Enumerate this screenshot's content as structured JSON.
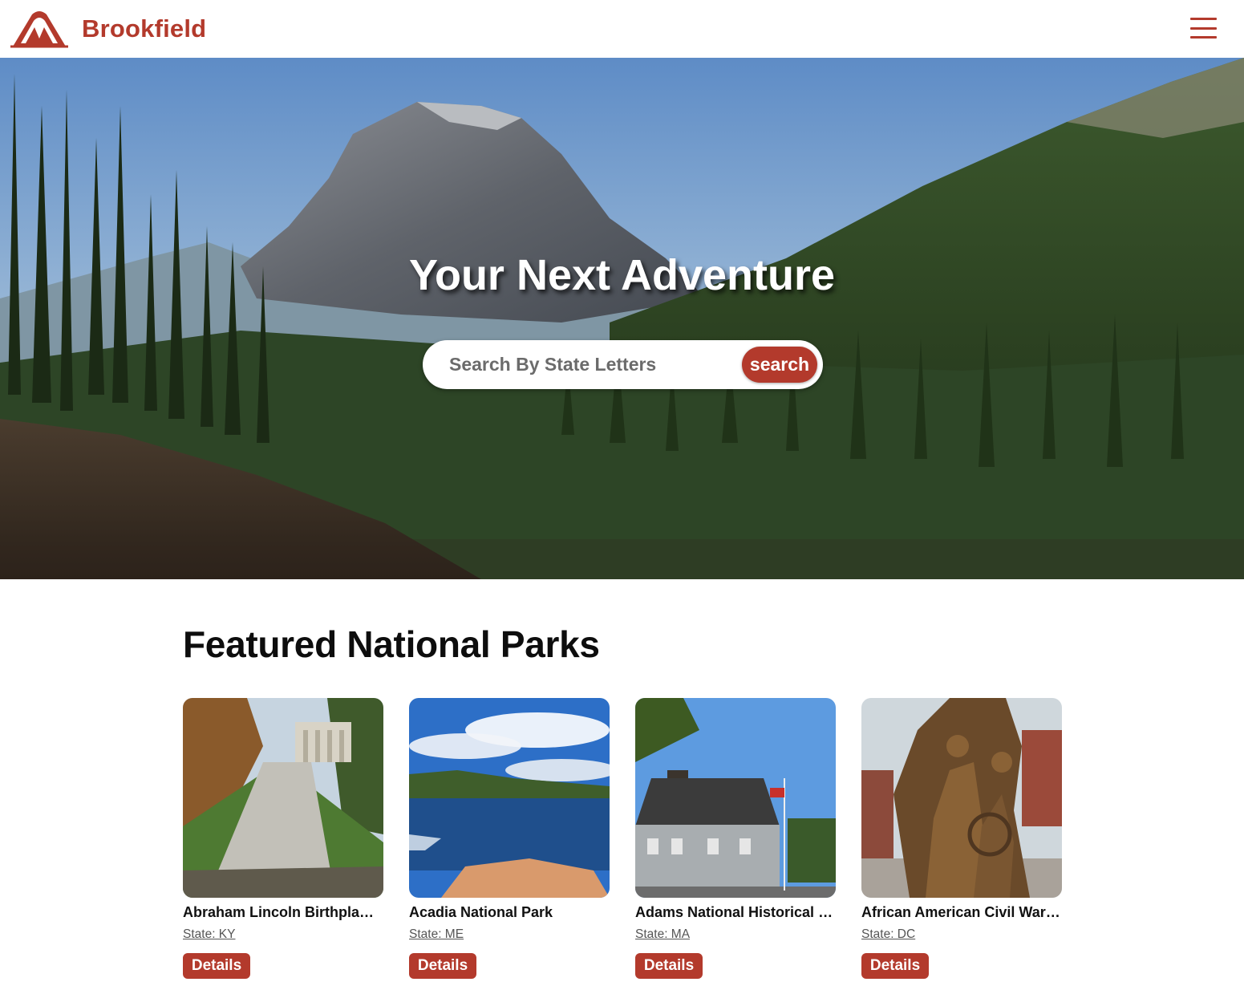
{
  "header": {
    "brand": "Brookfield",
    "logo_icon": "tent-icon",
    "menu_icon": "hamburger-menu-icon",
    "brand_color": "#b33a2c"
  },
  "hero": {
    "title": "Your Next Adventure",
    "search": {
      "placeholder": "Search By State Letters",
      "value": "",
      "button_label": "search"
    }
  },
  "featured": {
    "title": "Featured National Parks",
    "parks": [
      {
        "name": "Abraham Lincoln Birthplace National Historical Park",
        "state": "State: KY",
        "button": "Details"
      },
      {
        "name": "Acadia National Park",
        "state": "State: ME",
        "button": "Details"
      },
      {
        "name": "Adams National Historical Park",
        "state": "State: MA",
        "button": "Details"
      },
      {
        "name": "African American Civil War Memorial",
        "state": "State: DC",
        "button": "Details"
      }
    ]
  }
}
